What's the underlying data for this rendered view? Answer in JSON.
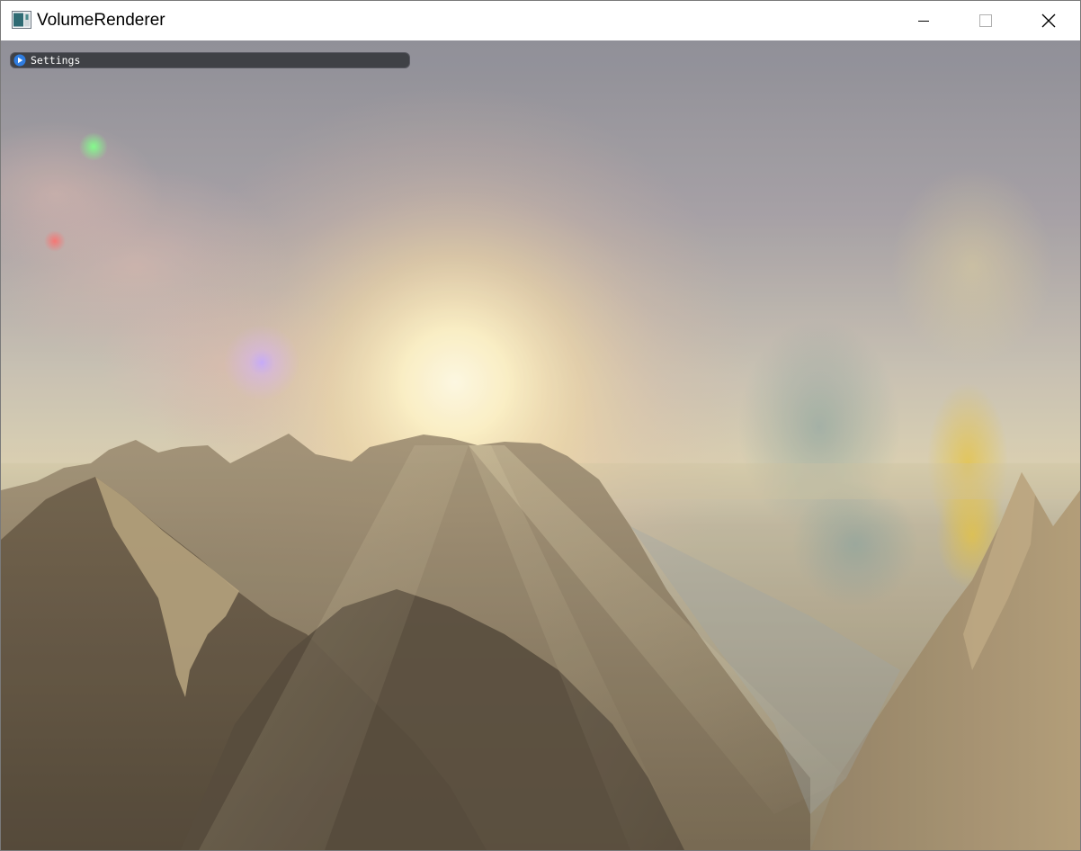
{
  "window": {
    "title": "VolumeRenderer",
    "icon": "app-window-icon",
    "controls": [
      "minimize-icon",
      "maximize-icon",
      "close-icon"
    ]
  },
  "overlay": {
    "panel_label": "Settings",
    "panel_state": "collapsed",
    "expand_icon": "play-arrow-icon",
    "accent_color": "#3b82f6"
  },
  "scene": {
    "description_colors": {
      "sky_top": "#8a8c98",
      "sun_glow": "#fff6d0",
      "mountain_dark": "#4d4234",
      "mountain_light": "#b09a76"
    }
  }
}
